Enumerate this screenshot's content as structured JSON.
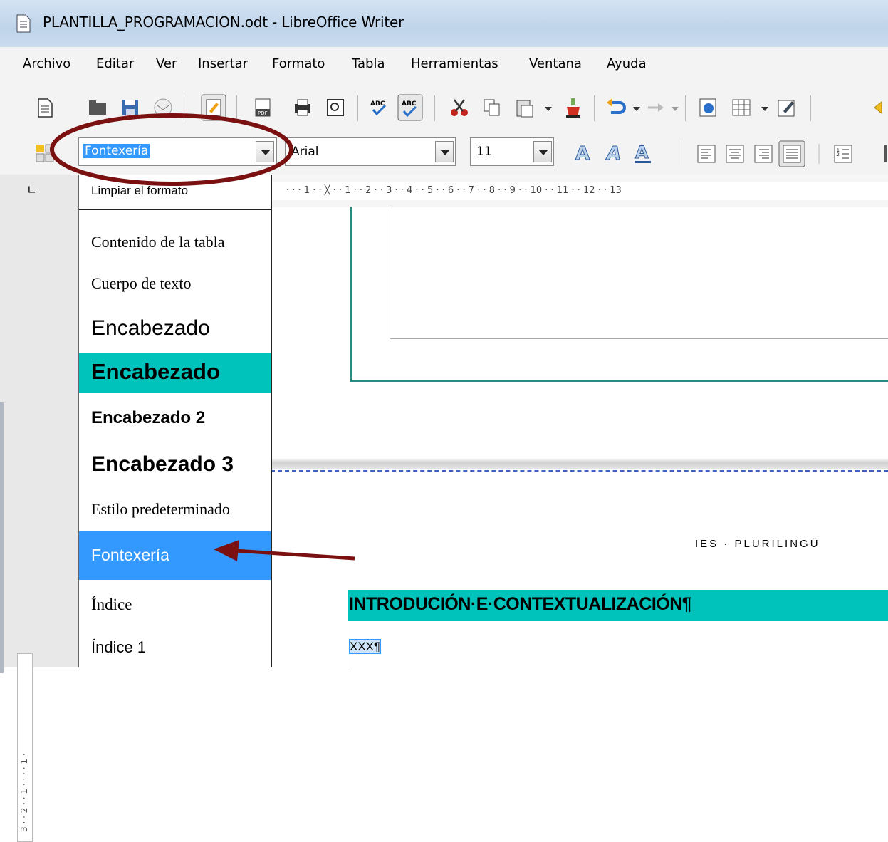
{
  "window": {
    "title": "PLANTILLA_PROGRAMACION.odt - LibreOffice Writer"
  },
  "menu": [
    "Archivo",
    "Editar",
    "Ver",
    "Insertar",
    "Formato",
    "Tabla",
    "Herramientas",
    "Ventana",
    "Ayuda"
  ],
  "toolbar": {
    "style_value": "Fontexería",
    "font_value": "Arial",
    "size_value": "11"
  },
  "ruler": {
    "labels": "· · · 1 · · ╳ · · 1 · · 2 · · 3 · · 4 · · 5 · · 6 · · 7 · · 8 · · 9 · · 10 · · 11 · · 12 · · 13"
  },
  "vruler": {
    "labels": "3 · · 2 · · 1 · · · · 1 ·"
  },
  "style_list": {
    "items": [
      "Limpiar el formato",
      "Contenido de la tabla",
      "Cuerpo de texto",
      "Encabezado",
      "Encabezado",
      "Encabezado 2",
      "Encabezado 3",
      "Estilo predeterminado",
      "Fontexería",
      "Índice",
      "Índice 1"
    ]
  },
  "document": {
    "header_text": "IES · PLURILINGÜ",
    "heading": "INTRODUCIÓN·E·CONTEXTUALIZACIÓN¶",
    "body": "XXX¶"
  },
  "annotation": {
    "color": "#7a1010",
    "highlight": "#00c4bc",
    "selection": "#3399ff"
  }
}
